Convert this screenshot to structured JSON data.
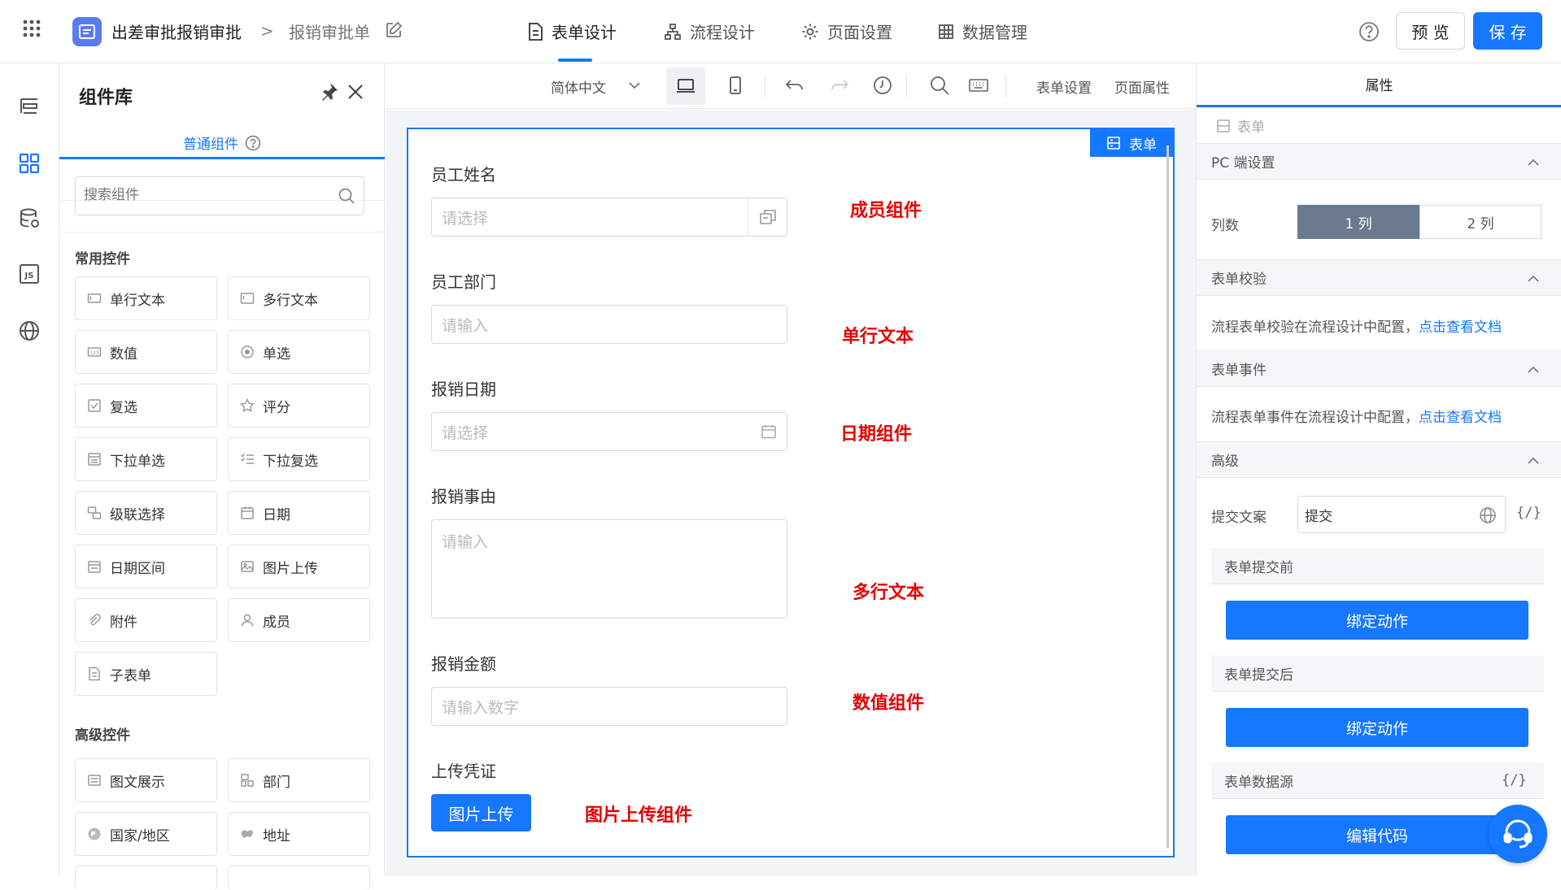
{
  "header": {
    "app_title": "出差审批报销审批",
    "breadcrumb_sep": ">",
    "breadcrumb": "报销审批单",
    "tabs": [
      {
        "label": "表单设计",
        "icon": "form-doc-icon"
      },
      {
        "label": "流程设计",
        "icon": "flow-icon"
      },
      {
        "label": "页面设置",
        "icon": "gear-icon"
      },
      {
        "label": "数据管理",
        "icon": "table-icon"
      }
    ],
    "preview_label": "预 览",
    "save_label": "保 存",
    "help_icon": "question-icon"
  },
  "rail": {
    "icons": [
      "outline-icon",
      "components-grid-icon",
      "datasource-icon",
      "js-icon",
      "globe-icon"
    ]
  },
  "library": {
    "title": "组件库",
    "tab_label": "普通组件",
    "search_placeholder": "搜索组件",
    "common_title": "常用控件",
    "common": [
      {
        "label": "单行文本",
        "icon": "input-icon"
      },
      {
        "label": "多行文本",
        "icon": "textarea-icon"
      },
      {
        "label": "数值",
        "icon": "number-icon"
      },
      {
        "label": "单选",
        "icon": "radio-icon"
      },
      {
        "label": "复选",
        "icon": "checkbox-icon"
      },
      {
        "label": "评分",
        "icon": "star-icon"
      },
      {
        "label": "下拉单选",
        "icon": "select-icon"
      },
      {
        "label": "下拉复选",
        "icon": "multiselect-icon"
      },
      {
        "label": "级联选择",
        "icon": "cascader-icon"
      },
      {
        "label": "日期",
        "icon": "calendar-icon"
      },
      {
        "label": "日期区间",
        "icon": "date-range-icon"
      },
      {
        "label": "图片上传",
        "icon": "image-icon"
      },
      {
        "label": "附件",
        "icon": "paperclip-icon"
      },
      {
        "label": "成员",
        "icon": "user-icon"
      },
      {
        "label": "子表单",
        "icon": "subform-icon"
      }
    ],
    "advanced_title": "高级控件",
    "advanced": [
      {
        "label": "图文展示",
        "icon": "richtext-icon"
      },
      {
        "label": "部门",
        "icon": "department-icon"
      },
      {
        "label": "国家/地区",
        "icon": "country-icon"
      },
      {
        "label": "地址",
        "icon": "map-icon"
      }
    ]
  },
  "toolbar": {
    "language": "简体中文",
    "form_settings": "表单设置",
    "page_props": "页面属性"
  },
  "form": {
    "badge": "表单",
    "fields": [
      {
        "label": "员工姓名",
        "placeholder": "请选择",
        "annotation": "成员组件"
      },
      {
        "label": "员工部门",
        "placeholder": "请输入",
        "annotation": "单行文本"
      },
      {
        "label": "报销日期",
        "placeholder": "请选择",
        "annotation": "日期组件"
      },
      {
        "label": "报销事由",
        "placeholder": "请输入",
        "annotation": "多行文本"
      },
      {
        "label": "报销金额",
        "placeholder": "请输入数字",
        "annotation": "数值组件"
      },
      {
        "label": "上传凭证",
        "button": "图片上传",
        "annotation": "图片上传组件"
      }
    ]
  },
  "props": {
    "tab": "属性",
    "crumb": "表单",
    "pc_settings": "PC 端设置",
    "columns_label": "列数",
    "col_options": [
      "1 列",
      "2 列"
    ],
    "validation_title": "表单校验",
    "validation_text": "流程表单校验在流程设计中配置，",
    "validation_link": "点击查看文档",
    "events_title": "表单事件",
    "events_text": "流程表单事件在流程设计中配置，",
    "events_link": "点击查看文档",
    "advanced_title": "高级",
    "submit_label": "提交文案",
    "submit_value": "提交",
    "code_tag": "{/}",
    "before_submit": "表单提交前",
    "after_submit": "表单提交后",
    "bind_action": "绑定动作",
    "datasource": "表单数据源",
    "edit_code": "编辑代码"
  }
}
